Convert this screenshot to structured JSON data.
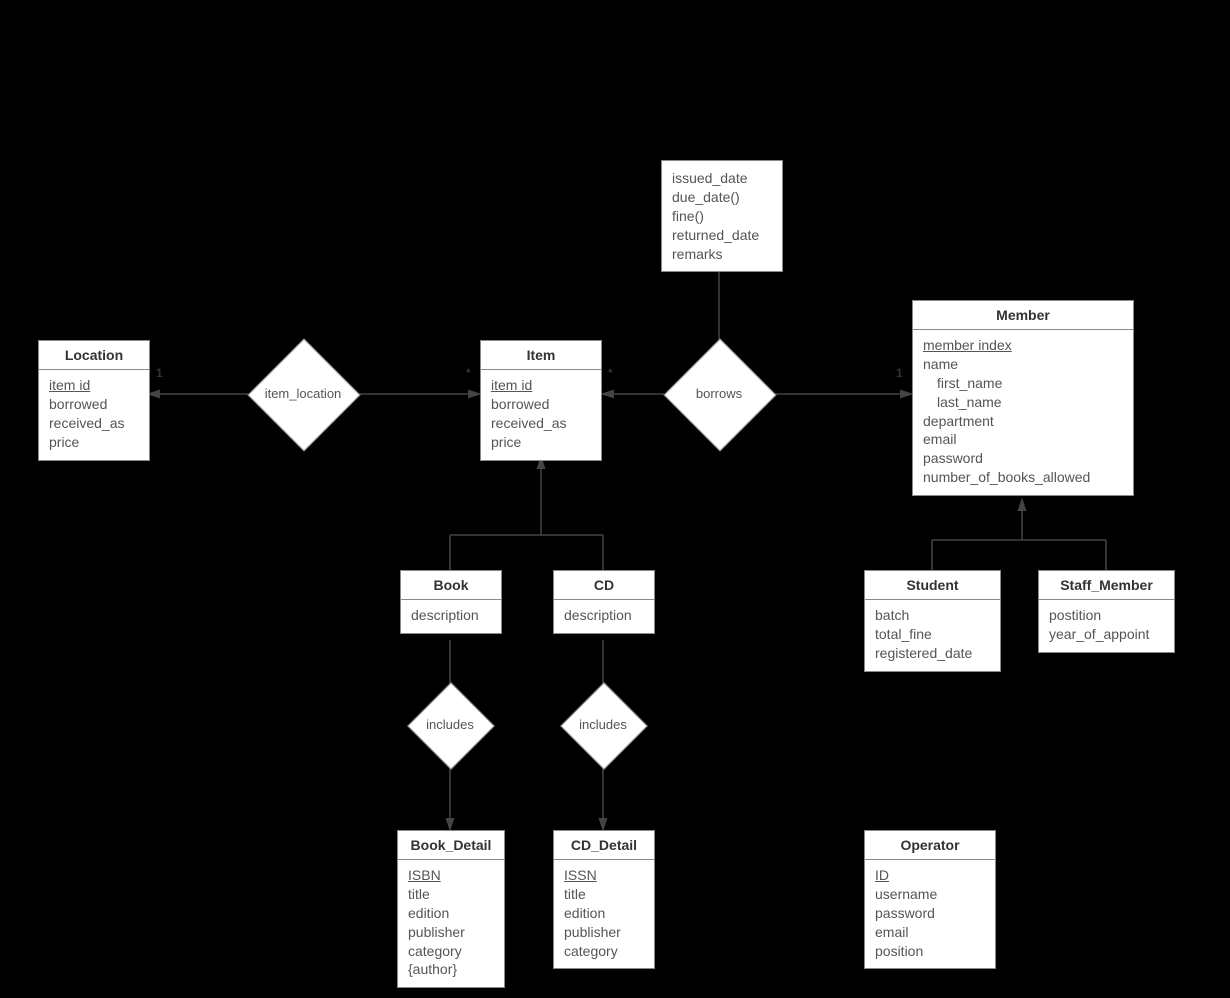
{
  "entities": {
    "location": {
      "title": "Location",
      "pk": "item id",
      "attrs": [
        "borrowed",
        "received_as",
        "price"
      ]
    },
    "item": {
      "title": "Item",
      "pk": "item id",
      "attrs": [
        "borrowed",
        "received_as",
        "price"
      ]
    },
    "member": {
      "title": "Member",
      "pk": "member index",
      "attrs_flat": [
        "name"
      ],
      "name_sub": [
        "first_name",
        "last_name"
      ],
      "attrs_rest": [
        "department",
        "email",
        "password",
        "number_of_books_allowed"
      ]
    },
    "book": {
      "title": "Book",
      "attr": "description"
    },
    "cd": {
      "title": "CD",
      "attr": "description"
    },
    "book_detail": {
      "title": "Book_Detail",
      "pk": "ISBN",
      "attrs": [
        "title",
        "edition",
        "publisher",
        "category",
        "{author}"
      ]
    },
    "cd_detail": {
      "title": "CD_Detail",
      "pk": "ISSN",
      "attrs": [
        "title",
        "edition",
        "publisher",
        "category"
      ]
    },
    "student": {
      "title": "Student",
      "attrs": [
        "batch",
        "total_fine",
        "registered_date"
      ]
    },
    "staff_member": {
      "title": "Staff_Member",
      "attrs": [
        "postition",
        "year_of_appoint"
      ]
    },
    "operator": {
      "title": "Operator",
      "pk": "ID",
      "attrs": [
        "username",
        "password",
        "email",
        "position"
      ]
    }
  },
  "relationships": {
    "item_location": "item_location",
    "borrows": "borrows",
    "includes_book": "includes",
    "includes_cd": "includes"
  },
  "borrows_attrs": [
    "issued_date",
    "due_date()",
    "fine()",
    "returned_date",
    "remarks"
  ],
  "cardinalities": {
    "location_side": "1",
    "item_left": "*",
    "item_right": "*",
    "member_side": "1"
  }
}
